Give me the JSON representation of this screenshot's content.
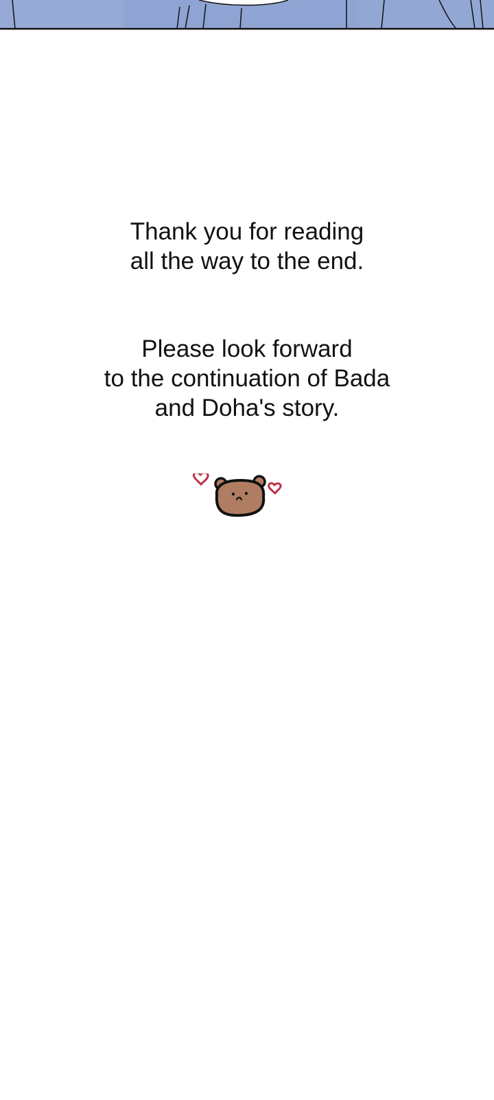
{
  "thanks_message": {
    "line1": "Thank you for reading",
    "line2": "all the way to the end."
  },
  "forward_message": {
    "line1": "Please look forward",
    "line2": "to the continuation of Bada",
    "line3": "and Doha's story."
  },
  "sticker": {
    "icon": "bear-with-hearts-icon",
    "bear_color": "#b07d62",
    "heart_color": "#c0304a"
  },
  "top_panel": {
    "color": "#8fa4d2"
  }
}
